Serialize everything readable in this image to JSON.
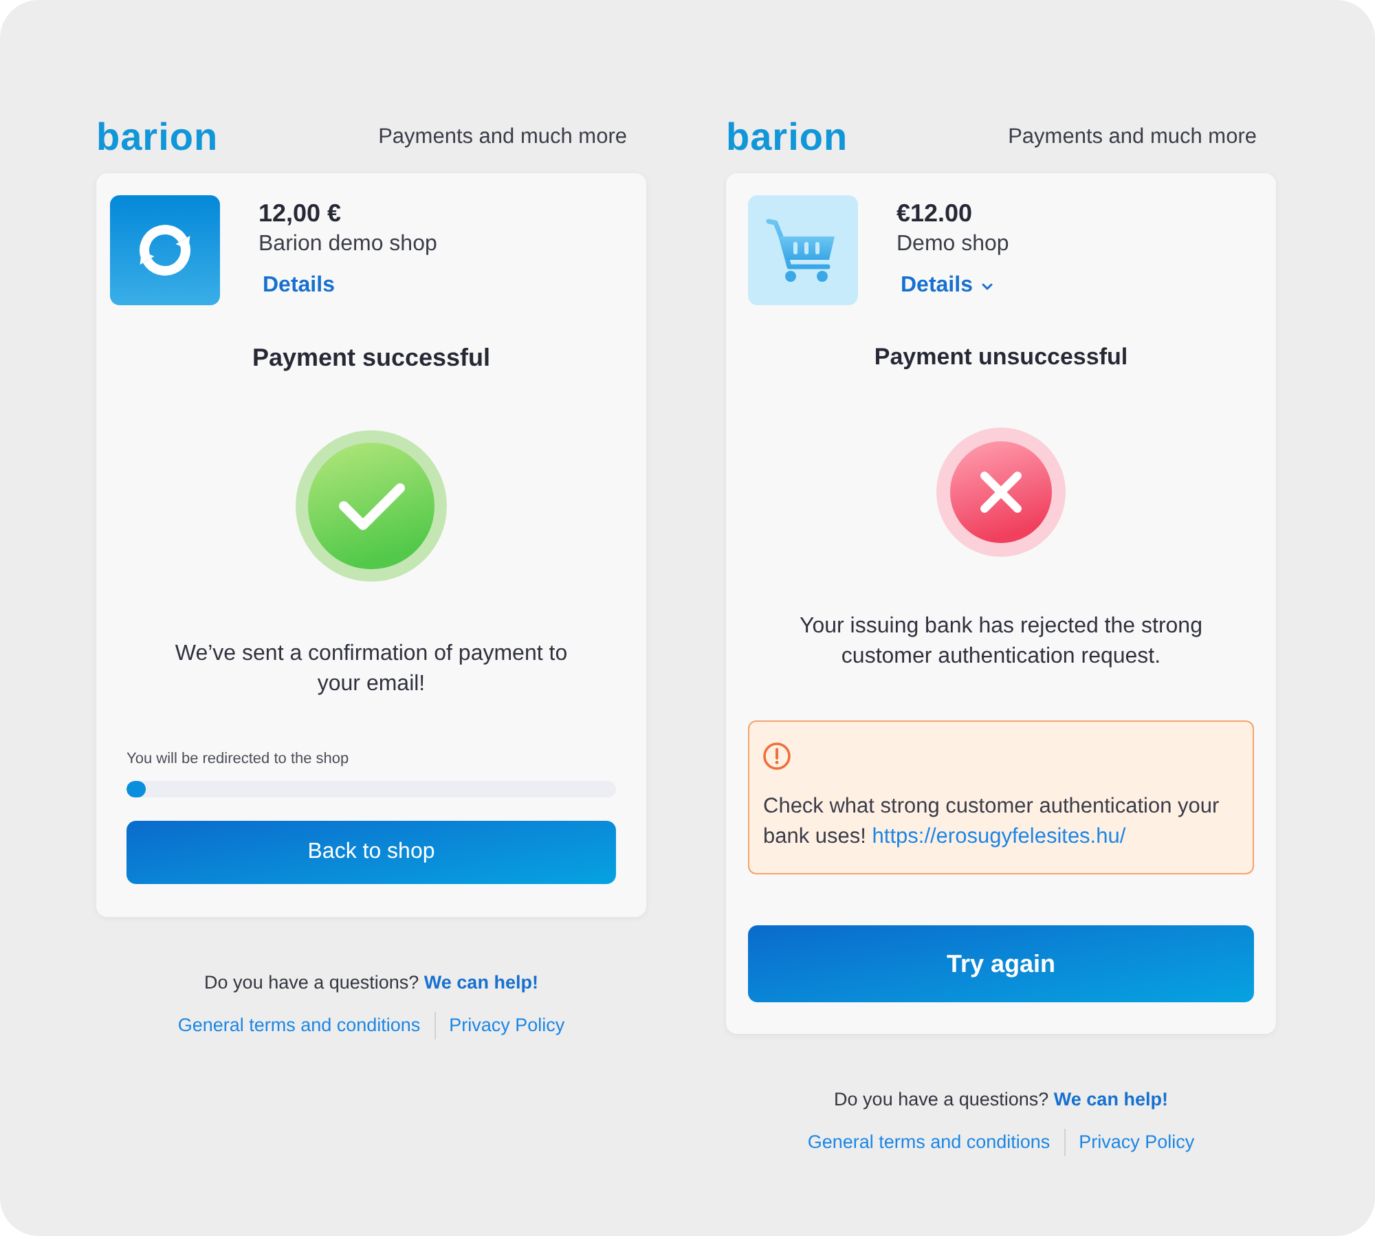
{
  "panels": [
    {
      "kind": "success",
      "logo": "barion",
      "tagline": "Payments and much more",
      "merchant": {
        "amount": "12,00 €",
        "shop": "Barion demo shop",
        "details": {
          "label": "Details",
          "dropdown": false
        }
      },
      "status_title": "Payment successful",
      "message": "We’ve sent a confirmation of payment to your email!",
      "redirect": {
        "label": "You will be redirected to the shop",
        "level": 0.04
      },
      "button": "Back to shop",
      "help": {
        "question": "Do you have a questions?",
        "link": "We can help!"
      },
      "links": [
        "General terms and conditions",
        "Privacy Policy"
      ]
    },
    {
      "kind": "failure",
      "logo": "barion",
      "tagline": "Payments and much more",
      "merchant": {
        "amount": "€12.00",
        "shop": "Demo shop",
        "details": {
          "label": "Details",
          "dropdown": true
        }
      },
      "status_title": "Payment unsuccessful",
      "message": "Your issuing bank has rejected the strong customer authentication request.",
      "alert": {
        "text": "Check what strong customer authentication your bank uses!",
        "link": "https://erosugyfelesites.hu/"
      },
      "button": "Try again",
      "help": {
        "question": "Do you have a questions?",
        "link": "We can help!"
      },
      "links": [
        "General terms and conditions",
        "Privacy Policy"
      ]
    }
  ]
}
